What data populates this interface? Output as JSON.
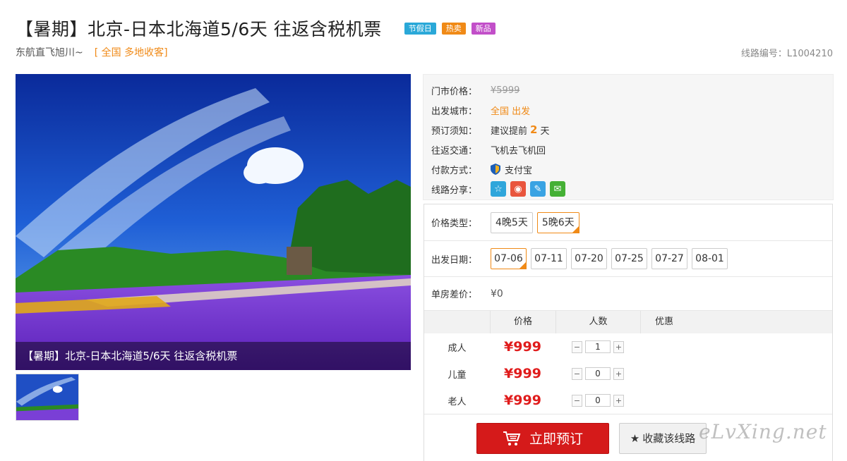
{
  "header": {
    "title": "【暑期】北京-日本北海道5/6天 往返含税机票",
    "tags": {
      "holiday": "节假日",
      "hot": "热卖",
      "new": "新品"
    },
    "subtitle": "东航直飞旭川~",
    "depart_note": "[ 全国 多地收客]",
    "route_no": "线路编号：L1004210"
  },
  "image": {
    "caption": "【暑期】北京-日本北海道5/6天 往返含税机票"
  },
  "info": {
    "market_price_label": "门市价格：",
    "market_price": "¥5999",
    "depart_city_label": "出发城市：",
    "depart_city": "全国 出发",
    "booking_label": "预订须知：",
    "booking_prefix": "建议提前",
    "booking_days": "2",
    "booking_suffix": "天",
    "transport_label": "往返交通：",
    "transport": "飞机去飞机回",
    "payment_label": "付款方式：",
    "payment": "支付宝",
    "share_label": "线路分享："
  },
  "options": {
    "price_type_label": "价格类型：",
    "price_types": [
      "4晚5天",
      "5晚6天"
    ],
    "date_label": "出发日期：",
    "dates": [
      "07-06",
      "07-11",
      "07-20",
      "07-25",
      "07-27",
      "08-01"
    ],
    "single_diff_label": "单房差价：",
    "single_diff": "¥0"
  },
  "price_table": {
    "headers": {
      "price": "价格",
      "qty": "人数",
      "discount": "优惠"
    },
    "rows": [
      {
        "type": "成人",
        "price": "¥999",
        "qty": "1"
      },
      {
        "type": "儿童",
        "price": "¥999",
        "qty": "0"
      },
      {
        "type": "老人",
        "price": "¥999",
        "qty": "0"
      }
    ],
    "minus": "−",
    "plus": "+"
  },
  "actions": {
    "book": "立即预订",
    "favorite": "收藏该线路"
  },
  "watermark": "eLvXing.net",
  "colors": {
    "accent": "#f08a17",
    "price_red": "#e01c1c",
    "book_red": "#d51a1a"
  }
}
